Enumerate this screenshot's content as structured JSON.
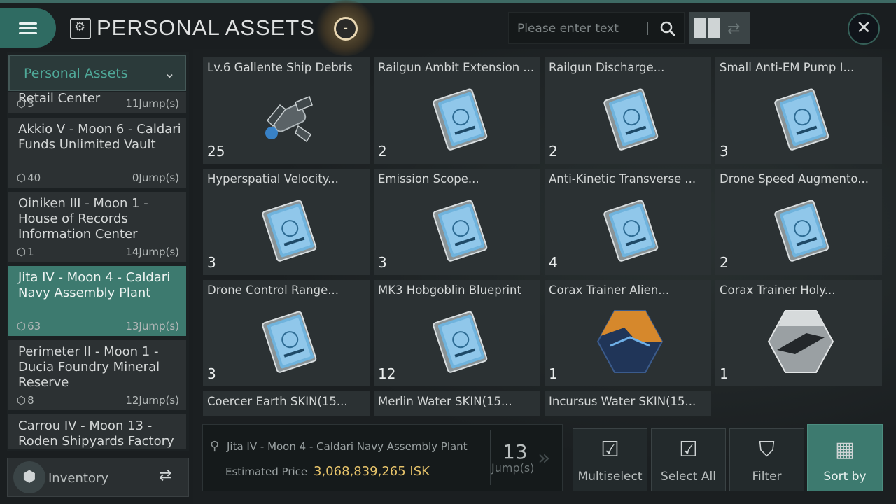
{
  "header": {
    "title": "PERSONAL ASSETS",
    "orb_symbol": "-",
    "search_placeholder": "Please enter text",
    "close_symbol": "✕"
  },
  "sidebar": {
    "dropdown_label": "Personal Assets",
    "locations": [
      {
        "name": "Retail Center",
        "count": "3",
        "jumps": "11Jump(s)"
      },
      {
        "name": "Akkio V - Moon 6 - Caldari Funds Unlimited Vault",
        "count": "40",
        "jumps": "0Jump(s)"
      },
      {
        "name": "Oiniken III - Moon 1 - House of Records Information Center",
        "count": "1",
        "jumps": "14Jump(s)"
      },
      {
        "name": "Jita IV - Moon 4 - Caldari Navy Assembly Plant",
        "count": "63",
        "jumps": "13Jump(s)"
      },
      {
        "name": "Perimeter II - Moon 1 - Ducia Foundry Mineral Reserve",
        "count": "8",
        "jumps": "12Jump(s)"
      },
      {
        "name": "Carrou IV - Moon 13 - Roden Shipyards Factory",
        "count": "",
        "jumps": ""
      }
    ],
    "inventory_label": "Inventory"
  },
  "items": [
    {
      "title": "Lv.6 Gallente Ship Debris",
      "qty": "25",
      "icon": "ship-debris"
    },
    {
      "title": "Railgun Ambit Extension ...",
      "qty": "2",
      "icon": "blueprint"
    },
    {
      "title": "Railgun Discharge...",
      "qty": "2",
      "icon": "blueprint"
    },
    {
      "title": "Small Anti-EM Pump I...",
      "qty": "3",
      "icon": "blueprint"
    },
    {
      "title": "Hyperspatial Velocity...",
      "qty": "3",
      "icon": "blueprint"
    },
    {
      "title": "Emission Scope...",
      "qty": "3",
      "icon": "blueprint"
    },
    {
      "title": "Anti-Kinetic Transverse ...",
      "qty": "4",
      "icon": "blueprint"
    },
    {
      "title": "Drone Speed Augmento...",
      "qty": "2",
      "icon": "blueprint"
    },
    {
      "title": "Drone Control Range...",
      "qty": "3",
      "icon": "blueprint"
    },
    {
      "title": "MK3 Hobgoblin Blueprint",
      "qty": "12",
      "icon": "blueprint"
    },
    {
      "title": "Corax Trainer Alien...",
      "qty": "1",
      "icon": "skin-orange"
    },
    {
      "title": "Corax Trainer Holy...",
      "qty": "1",
      "icon": "skin-silver"
    },
    {
      "title": "Coercer Earth  SKIN(15...",
      "qty": "",
      "icon": ""
    },
    {
      "title": "Merlin Water  SKIN(15...",
      "qty": "",
      "icon": ""
    },
    {
      "title": "Incursus Water  SKIN(15...",
      "qty": "",
      "icon": ""
    }
  ],
  "footer": {
    "location": "Jita IV - Moon 4 - Caldari Navy Assembly Plant",
    "price_label": "Estimated Price",
    "price_value": "3,068,839,265 ISK",
    "jumps_number": "13",
    "jumps_label": "Jump(s)",
    "actions": {
      "multiselect": "Multiselect",
      "select_all": "Select All",
      "filter": "Filter",
      "sort_by": "Sort by"
    }
  },
  "colors": {
    "accent": "#3d7a6f",
    "accent_text": "#4fa898",
    "price": "#e6c36a",
    "background": "#1a1e20"
  }
}
